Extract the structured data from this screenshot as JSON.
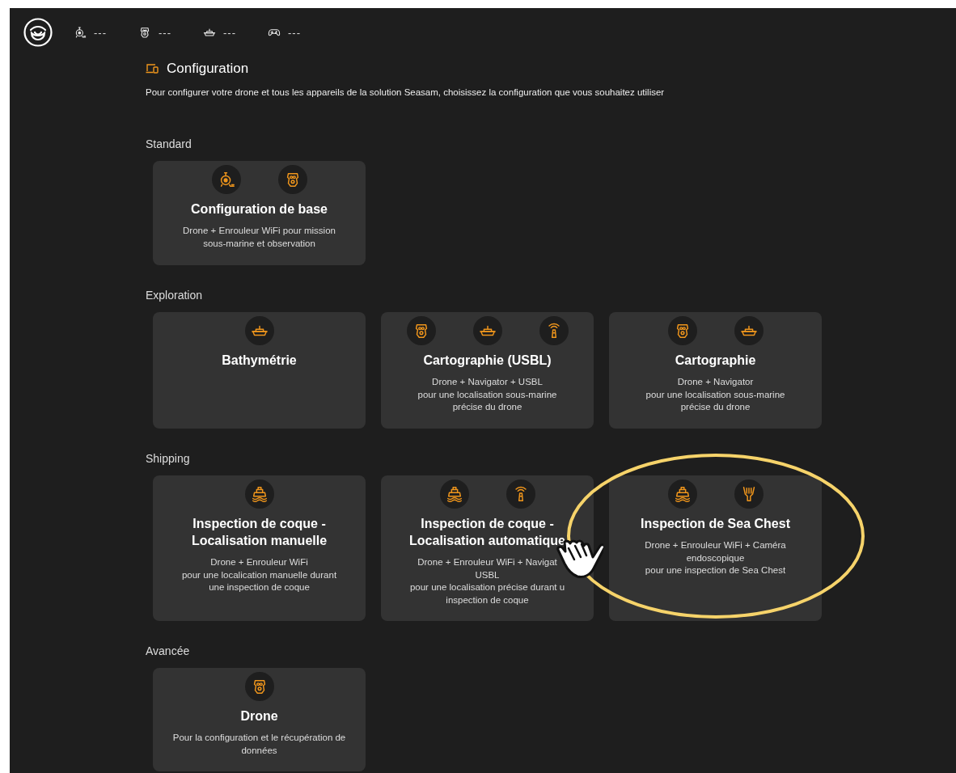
{
  "status_bar": [
    {
      "kind": "reel",
      "value": "---"
    },
    {
      "kind": "drone",
      "value": "---"
    },
    {
      "kind": "boat",
      "value": "---"
    },
    {
      "kind": "gamepad",
      "value": "---"
    }
  ],
  "page": {
    "title": "Configuration",
    "description": "Pour configurer votre drone et tous les appareils de la solution Seasam, choisissez la configuration que vous souhaitez utiliser"
  },
  "sections": [
    {
      "title": "Standard",
      "cards": [
        {
          "icons": [
            {
              "kind": "reel"
            },
            {
              "kind": "drone"
            }
          ],
          "title": "Configuration de base",
          "description": "Drone + Enrouleur WiFi pour mission\nsous-marine et observation"
        }
      ]
    },
    {
      "title": "Exploration",
      "cards": [
        {
          "icons": [
            {
              "kind": "boat"
            }
          ],
          "title": "Bathymétrie"
        },
        {
          "icons": [
            {
              "kind": "drone"
            },
            {
              "kind": "boat"
            },
            {
              "kind": "beacon"
            }
          ],
          "title": "Cartographie (USBL)",
          "description": "Drone + Navigator + USBL\npour une localisation sous-marine\nprécise du drone"
        },
        {
          "icons": [
            {
              "kind": "drone"
            },
            {
              "kind": "boat"
            }
          ],
          "title": "Cartographie",
          "description": "Drone + Navigator\npour une localisation sous-marine\nprécise du drone"
        }
      ]
    },
    {
      "title": "Shipping",
      "cards": [
        {
          "icons": [
            {
              "kind": "ship"
            }
          ],
          "title": "Inspection de coque -\nLocalisation manuelle",
          "description": "Drone + Enrouleur WiFi\npour une localication manuelle durant\nune inspection de coque"
        },
        {
          "icons": [
            {
              "kind": "ship"
            },
            {
              "kind": "beacon"
            }
          ],
          "title": "Inspection de coque -\nLocalisation automatique",
          "description": "Drone + Enrouleur WiFi + Navigat\nUSBL\npour une localisation précise durant u\ninspection de coque"
        },
        {
          "icons": [
            {
              "kind": "ship"
            },
            {
              "kind": "camera"
            }
          ],
          "title": "Inspection de Sea Chest",
          "description": "Drone + Enrouleur WiFi + Caméra\nendoscopique\n pour une inspection de Sea Chest"
        }
      ]
    },
    {
      "title": "Avancée",
      "cards": [
        {
          "icons": [
            {
              "kind": "drone"
            }
          ],
          "title": "Drone",
          "description": "Pour la configuration et le récupération de\ndonnées"
        }
      ]
    }
  ],
  "annotation": {
    "highlight": true,
    "pointer": true
  }
}
